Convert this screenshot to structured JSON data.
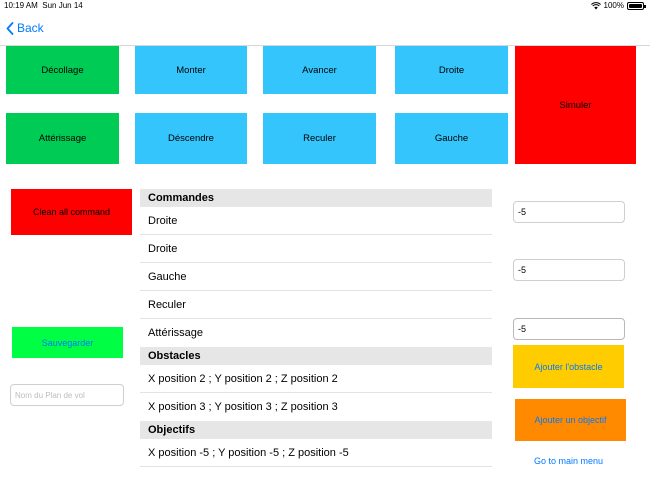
{
  "status": {
    "time": "10:19 AM",
    "date": "Sun Jun 14",
    "battery": "100%"
  },
  "nav": {
    "back_label": "Back"
  },
  "commands": {
    "decollage": "Décollage",
    "monter": "Monter",
    "avancer": "Avancer",
    "droite": "Droite",
    "simuler": "Simuler",
    "atterrissage": "Attérissage",
    "descendre": "Déscendre",
    "reculer": "Reculer",
    "gauche": "Gauche"
  },
  "left": {
    "clean_label": "Clean all command",
    "save_label": "Sauvegarder",
    "plan_placeholder": "Nom du Plan de vol"
  },
  "list": {
    "commands_header": "Commandes",
    "commands": [
      "Droite",
      "Droite",
      "Gauche",
      "Reculer",
      "Attérissage"
    ],
    "obstacles_header": "Obstacles",
    "obstacles": [
      "X position 2 ; Y position 2 ; Z position 2",
      "X position 3 ; Y position 3 ; Z position 3"
    ],
    "objectives_header": "Objectifs",
    "objectives": [
      "X position -5 ; Y position -5 ; Z position -5"
    ]
  },
  "right": {
    "x_value": "-5",
    "y_value": "-5",
    "z_value": "-5",
    "add_obstacle_label": "Ajouter l'obstacle",
    "add_objective_label": "Ajouter un objectif",
    "main_menu_label": "Go to main menu"
  },
  "colors": {
    "green": "#00cc55",
    "blue": "#33c5fb",
    "red": "#ff0000",
    "save_green": "#00ff44",
    "obstacle_yellow": "#ffcc00",
    "objective_orange": "#ff8a00",
    "link_blue": "#007aff"
  }
}
